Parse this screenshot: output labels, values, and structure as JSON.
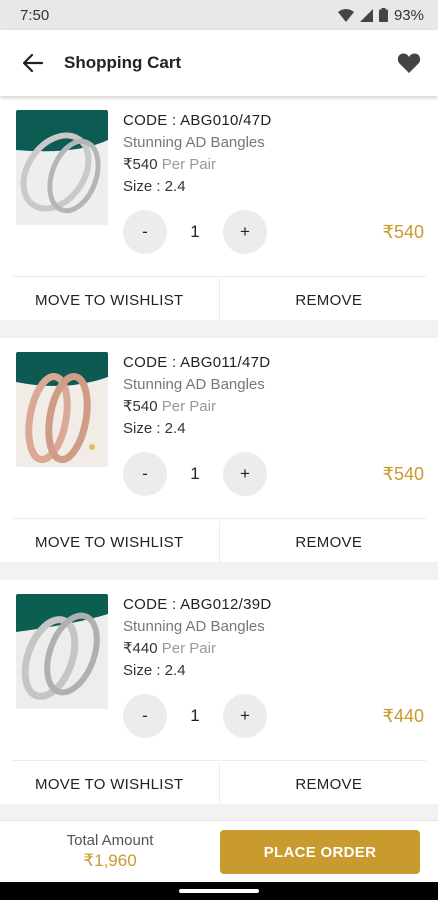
{
  "status": {
    "time": "7:50",
    "battery": "93%"
  },
  "header": {
    "title": "Shopping Cart"
  },
  "items": [
    {
      "code": "CODE : ABG010/47D",
      "name": "Stunning AD Bangles",
      "price": "₹540",
      "unit": "Per Pair",
      "size": "Size : 2.4",
      "qty": "1",
      "total": "₹540"
    },
    {
      "code": "CODE : ABG011/47D",
      "name": "Stunning AD Bangles",
      "price": "₹540",
      "unit": "Per Pair",
      "size": "Size : 2.4",
      "qty": "1",
      "total": "₹540"
    },
    {
      "code": "CODE : ABG012/39D",
      "name": "Stunning AD Bangles",
      "price": "₹440",
      "unit": "Per Pair",
      "size": "Size : 2.4",
      "qty": "1",
      "total": "₹440"
    }
  ],
  "actions": {
    "wishlist": "MOVE TO WISHLIST",
    "remove": "REMOVE",
    "minus": "-",
    "plus": "+"
  },
  "footer": {
    "total_label": "Total Amount",
    "total_value": "₹1,960",
    "order_label": "PLACE ORDER"
  },
  "colors": {
    "accent": "#c99a2e"
  }
}
